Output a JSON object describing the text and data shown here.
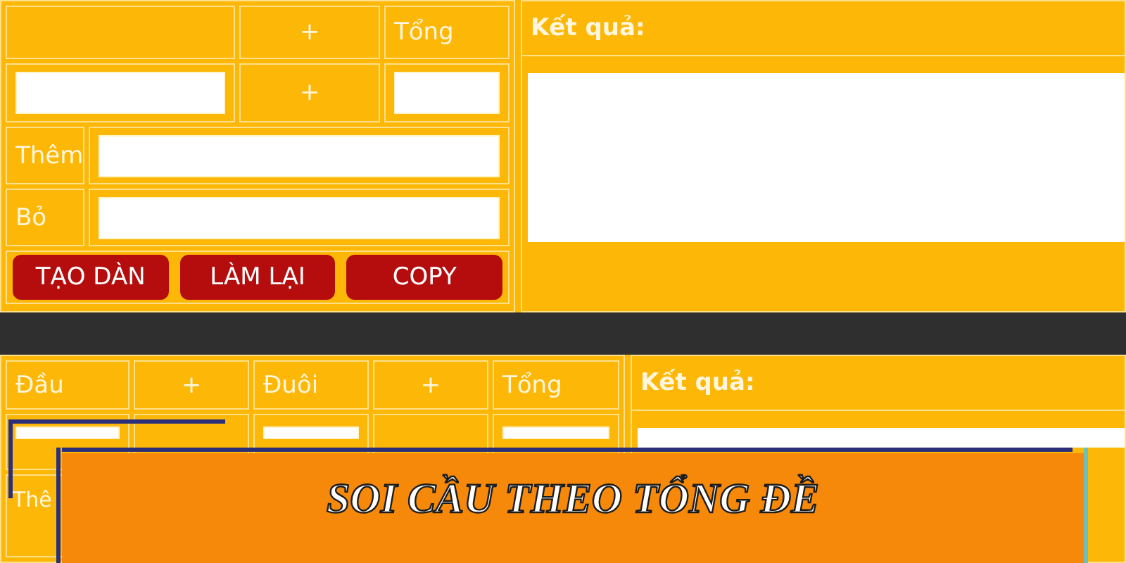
{
  "top_form": {
    "header_cells": [
      "",
      "+",
      "Tổng"
    ],
    "input_row_sign": "+",
    "rows": [
      {
        "label": "Thêm"
      },
      {
        "label": "Bỏ"
      }
    ],
    "buttons": [
      "TẠO DÀN",
      "LÀM LẠI",
      "COPY"
    ]
  },
  "top_result": {
    "label": "Kết quả:"
  },
  "bottom_form": {
    "header_cells": [
      "Đầu",
      "+",
      "Đuôi",
      "+",
      "Tổng"
    ],
    "row_label": "Thê"
  },
  "bottom_result": {
    "label": "Kết quả:"
  },
  "banner": {
    "title": "SOI CẦU THEO TỔNG ĐỀ"
  }
}
